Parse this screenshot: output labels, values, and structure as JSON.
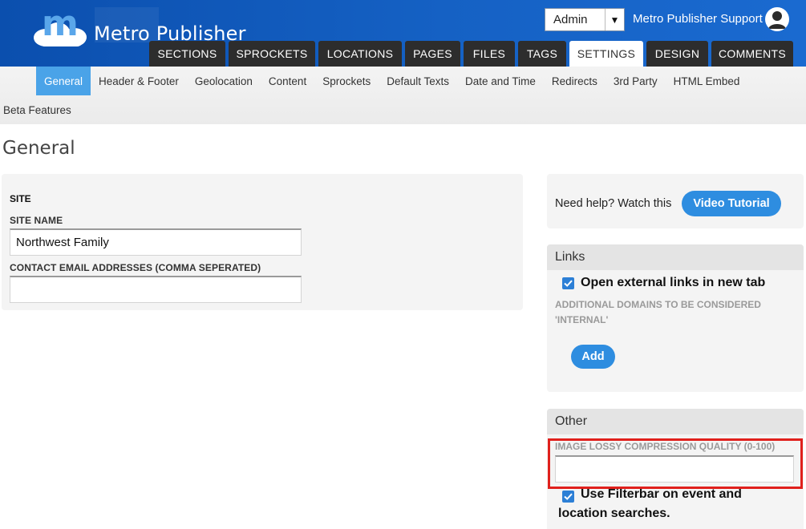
{
  "header": {
    "logo_letter": "m",
    "app_title": "Metro Publisher",
    "role_select": {
      "value": "Admin"
    },
    "support_link": "Metro Publisher Support",
    "main_tabs": [
      {
        "label": "SECTIONS"
      },
      {
        "label": "SPROCKETS"
      },
      {
        "label": "LOCATIONS"
      },
      {
        "label": "PAGES"
      },
      {
        "label": "FILES"
      },
      {
        "label": "TAGS"
      },
      {
        "label": "SETTINGS",
        "active": true
      },
      {
        "label": "DESIGN"
      },
      {
        "label": "COMMENTS"
      }
    ]
  },
  "subnav": {
    "items": [
      {
        "label": "General",
        "active": true
      },
      {
        "label": "Header & Footer"
      },
      {
        "label": "Geolocation"
      },
      {
        "label": "Content"
      },
      {
        "label": "Sprockets"
      },
      {
        "label": "Default Texts"
      },
      {
        "label": "Date and Time"
      },
      {
        "label": "Redirects"
      },
      {
        "label": "3rd Party"
      },
      {
        "label": "HTML Embed"
      }
    ],
    "overflow_item": "Beta Features"
  },
  "page": {
    "title": "General"
  },
  "site_panel": {
    "section_label": "SITE",
    "site_name_label": "SITE NAME",
    "site_name_value": "Northwest Family",
    "contact_email_label": "CONTACT EMAIL ADDRESSES (COMMA SEPERATED)",
    "contact_email_value": ""
  },
  "help_panel": {
    "text": "Need help? Watch this",
    "button_label": "Video Tutorial"
  },
  "links_panel": {
    "title": "Links",
    "open_external_label": "Open external links in new tab",
    "open_external_checked": true,
    "internal_domains_label_line1": "ADDITIONAL DOMAINS TO BE CONSIDERED",
    "internal_domains_label_line2": "'INTERNAL'",
    "add_button_label": "Add"
  },
  "other_panel": {
    "title": "Other",
    "compression_label": "IMAGE LOSSY COMPRESSION QUALITY (0-100)",
    "compression_value": "",
    "filterbar_label_line1": "Use Filterbar on event and",
    "filterbar_label_line2": "location searches.",
    "filterbar_checked": true
  },
  "colors": {
    "header_blue": "#1561c4",
    "active_subnav": "#4aa3e8",
    "button_blue": "#2e8de0",
    "highlight_red": "#e0201c"
  }
}
